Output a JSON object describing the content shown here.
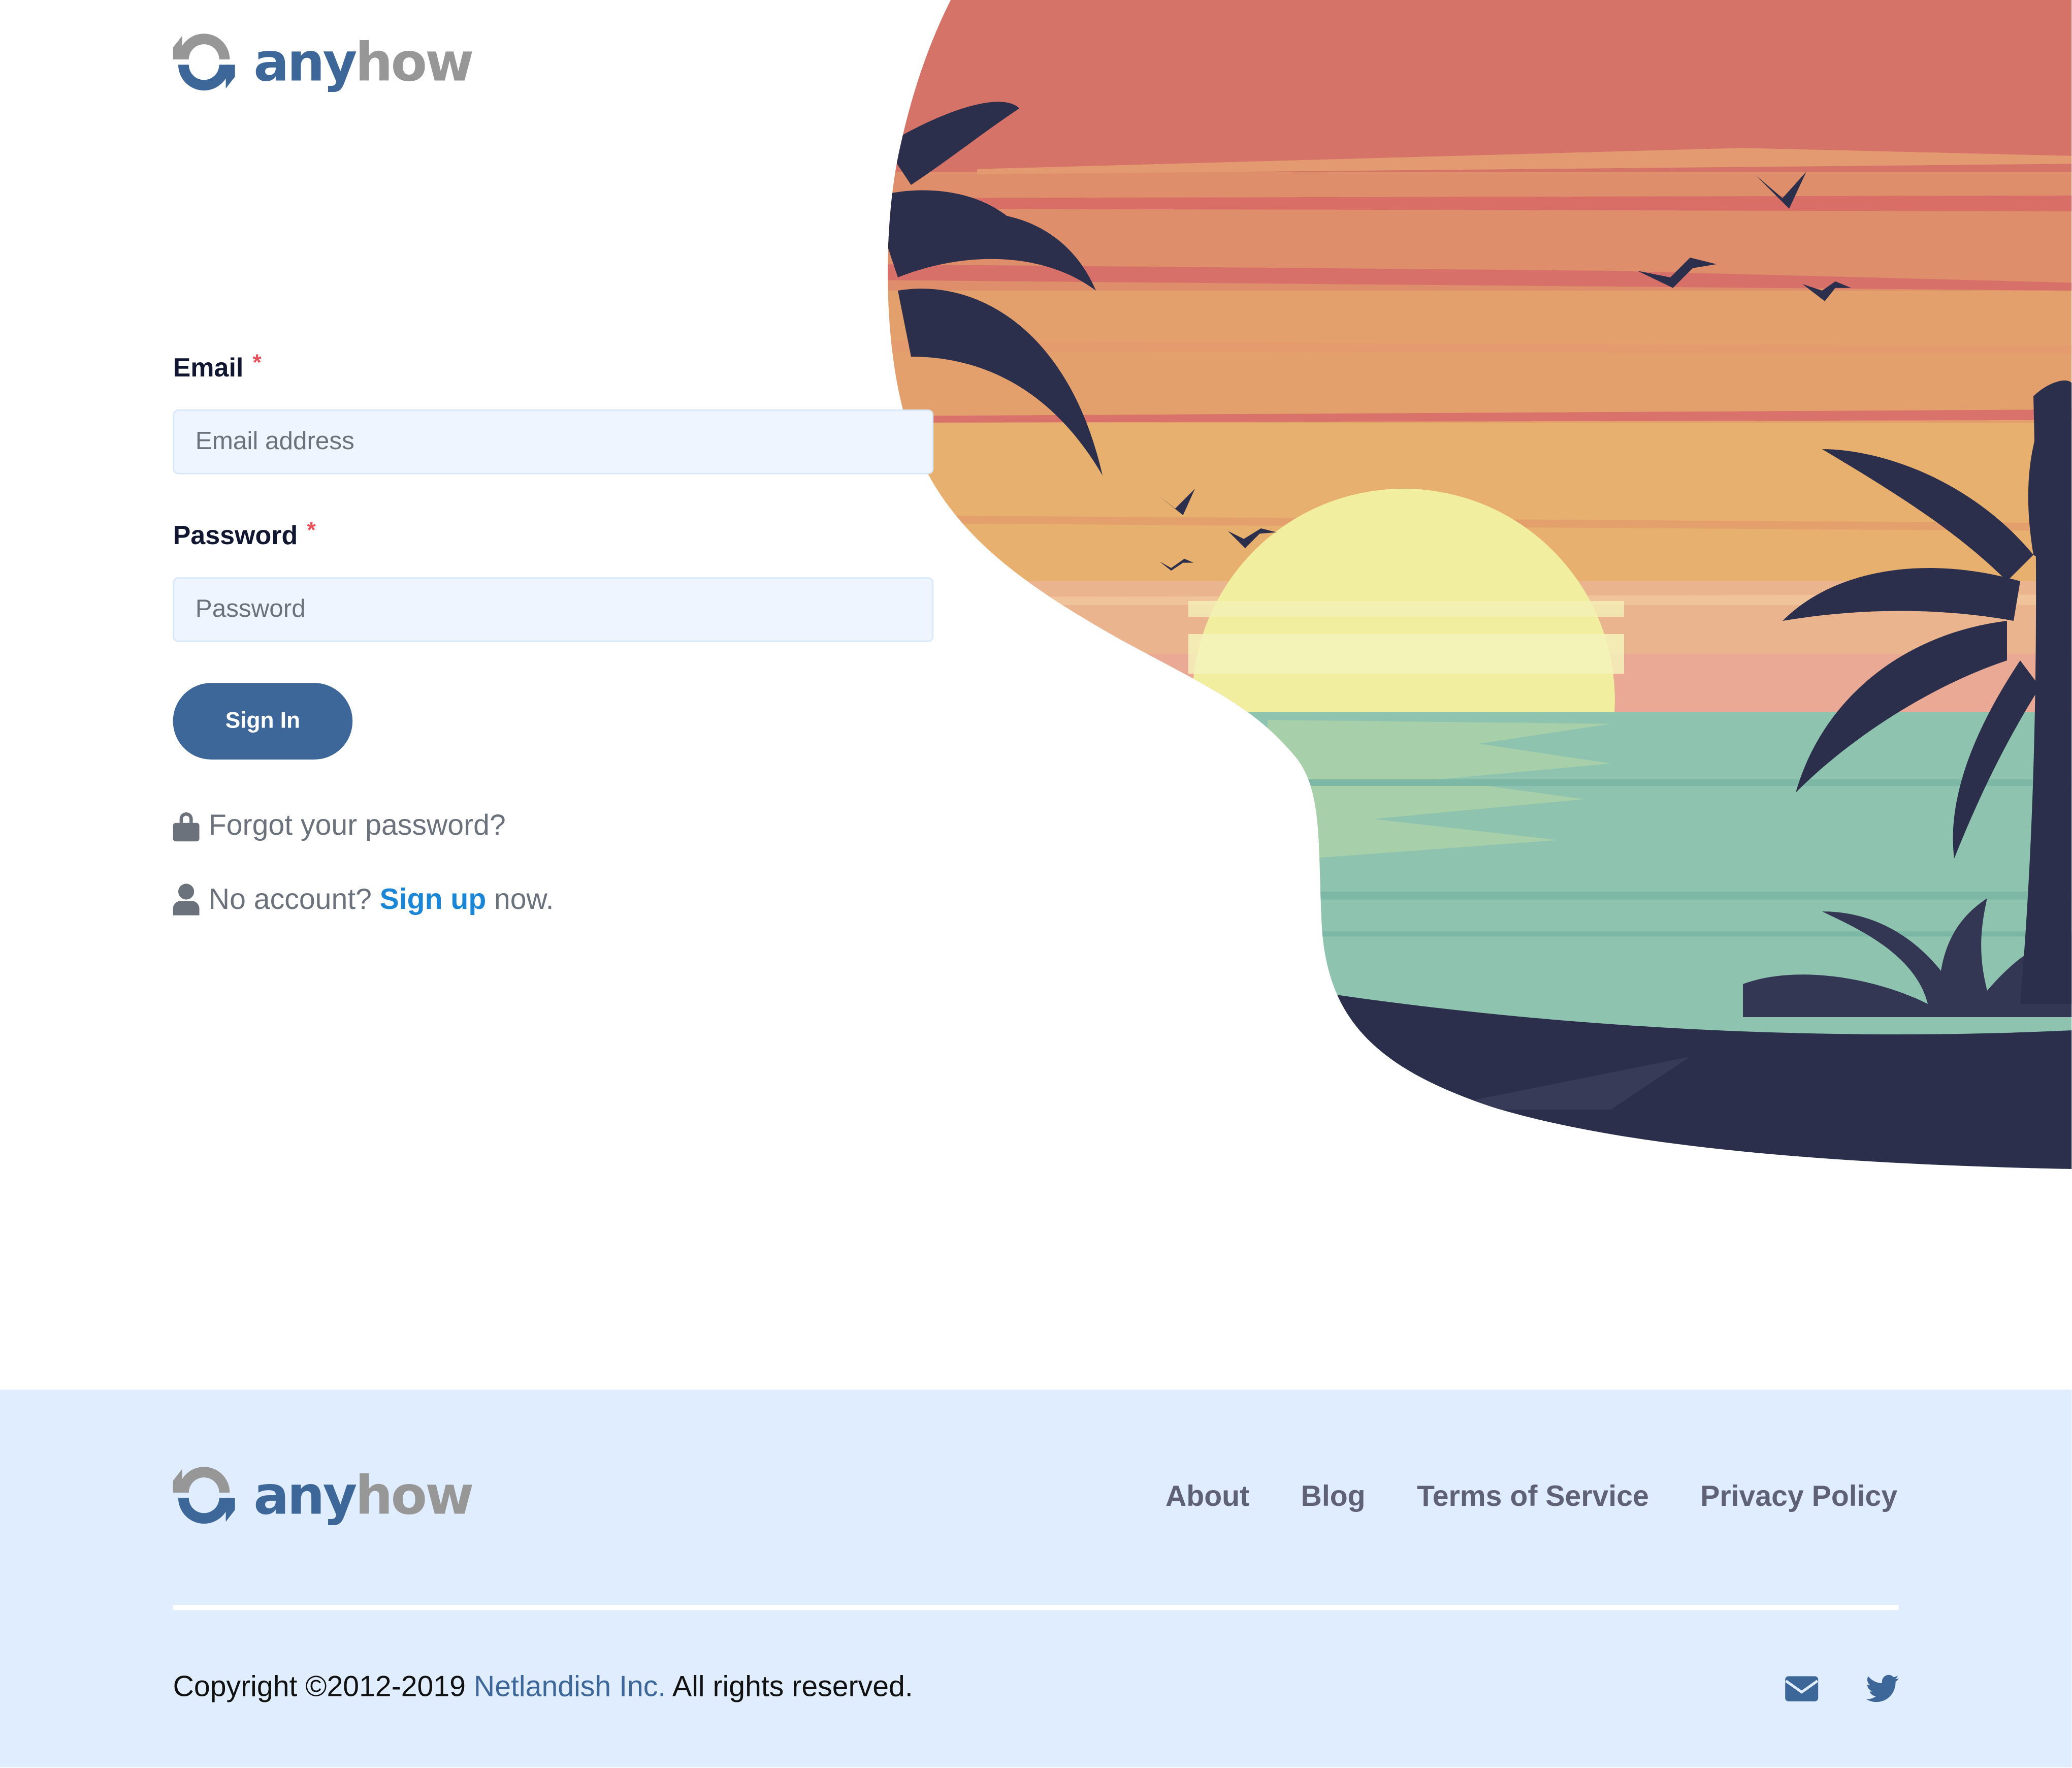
{
  "brand": {
    "part1": "any",
    "part2": "how",
    "color_primary": "#3e6799",
    "color_secondary": "#979797"
  },
  "hero": {
    "illustration": "tropical-sunset-beach-with-palm-trees-and-birds"
  },
  "form": {
    "email_label": "Email",
    "email_required": "*",
    "email_placeholder": "Email address",
    "email_value": "",
    "password_label": "Password",
    "password_required": "*",
    "password_placeholder": "Password",
    "password_value": "",
    "submit_label": "Sign In",
    "forgot_icon": "lock-icon",
    "forgot_label": "Forgot your password?",
    "signup_icon": "user-icon",
    "signup_prefix": "No account?",
    "signup_link": "Sign up",
    "signup_suffix": "now."
  },
  "footer": {
    "nav": [
      {
        "label": "About"
      },
      {
        "label": "Blog"
      },
      {
        "label": "Terms of Service"
      },
      {
        "label": "Privacy Policy"
      }
    ],
    "copyright_prefix": "Copyright ©2012-2019",
    "company": "Netlandish Inc.",
    "copyright_suffix": "All rights reserved.",
    "social": [
      {
        "icon": "envelope-icon"
      },
      {
        "icon": "twitter-icon"
      }
    ]
  },
  "colors": {
    "accent": "#3e6799",
    "link": "#1b86d6",
    "required": "#e8505b",
    "footer_bg": "#e0edfe"
  }
}
